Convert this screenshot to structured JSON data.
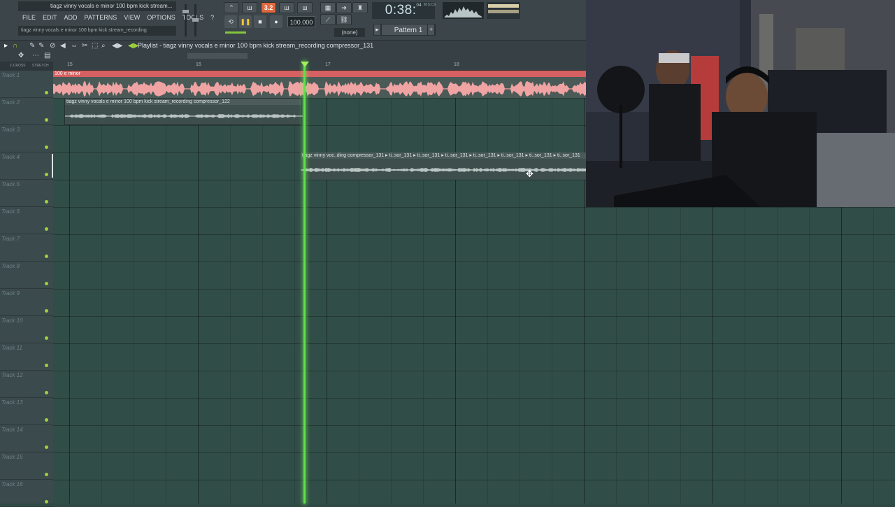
{
  "app": {
    "window_title": "tiagz vinny vocals e minor 100 bpm kick stream...",
    "hint_text": "tiagz vinny vocals e minor 100 bpm kick stream_recording"
  },
  "menu": [
    "FILE",
    "EDIT",
    "ADD",
    "PATTERNS",
    "VIEW",
    "OPTIONS",
    "TOOLS",
    "?"
  ],
  "transport": {
    "time_main": "0:38",
    "time_frac": "04",
    "time_unit": "M:S:CS",
    "tempo": "100.000",
    "pattern": "Pattern 1",
    "mixer_target": "(none)",
    "snap_value": "3.2"
  },
  "playlist": {
    "title": "Playlist - tiagz vinny vocals e minor 100 bpm kick stream_recording compressor_131",
    "snap_labels": [
      "Z-CROSS",
      "STRETCH"
    ],
    "ruler": [
      "15",
      "16",
      "17",
      "18"
    ],
    "tracks": [
      "Track 1",
      "Track 2",
      "Track 3",
      "Track 4",
      "Track 5",
      "Track 6",
      "Track 7",
      "Track 8",
      "Track 9",
      "Track 10",
      "Track 11",
      "Track 12",
      "Track 13",
      "Track 14",
      "Track 15",
      "Track 16"
    ],
    "clips": {
      "beat": "100 e minor",
      "vocal_122": "tiagz vinny vocals e minor 100 bpm kick stream_recording compressor_122",
      "vocal_131": "tiagz vinny voc..ding compressor_131 ▸ ti..sor_131 ▸ ti..sor_131 ▸ ti..sor_131 ▸ ti..sor_131 ▸ ti..sor_131 ▸ ti..sor_131 ▸ ti..sor_131"
    }
  },
  "colors": {
    "accent_orange": "#e0683e",
    "clip_red": "#d76062",
    "playhead_green": "#5fe04a",
    "grid_bg": "#314d47"
  },
  "icons": [
    "minimize-icon",
    "maximize-icon",
    "close-icon",
    "draw-icon",
    "paint-icon",
    "delete-icon",
    "mute-icon",
    "slip-icon",
    "slice-icon",
    "select-icon",
    "zoom-icon",
    "playback-icon",
    "play-icon",
    "pause-icon",
    "stop-icon",
    "record-icon",
    "loop-icon",
    "link-icon"
  ]
}
